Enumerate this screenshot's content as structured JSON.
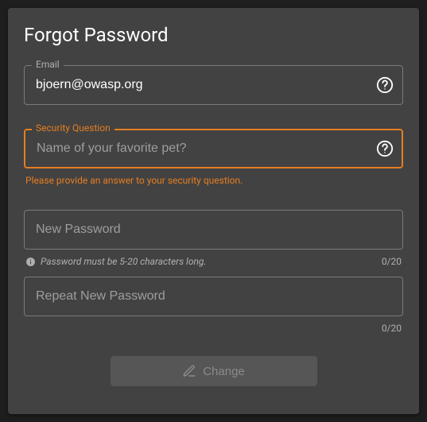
{
  "title": "Forgot Password",
  "email": {
    "label": "Email",
    "value": "bjoern@owasp.org"
  },
  "security": {
    "label": "Security Question",
    "placeholder": "Name of your favorite pet?",
    "value": "",
    "error": "Please provide an answer to your security question."
  },
  "newPassword": {
    "placeholder": "New Password",
    "hint": "Password must be 5-20 characters long.",
    "counter": "0/20"
  },
  "repeatPassword": {
    "placeholder": "Repeat New Password",
    "counter": "0/20"
  },
  "button": {
    "label": "Change"
  },
  "colors": {
    "accent": "#e67e22",
    "cardBg": "#424242"
  }
}
